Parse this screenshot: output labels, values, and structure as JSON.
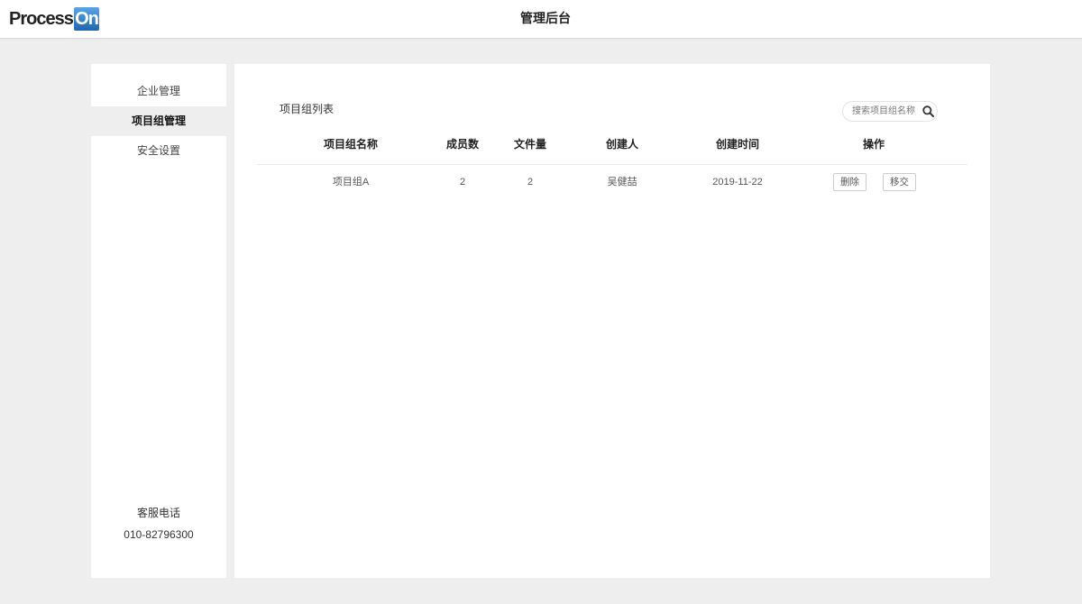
{
  "app": {
    "logo_text": "Process",
    "logo_badge": "On",
    "title": "管理后台"
  },
  "colors": {
    "background": "#eeeeee",
    "panel": "#ffffff",
    "logo_badge": "#2a75c2",
    "selected_menu": "#eeeeee"
  },
  "sidebar": {
    "items": [
      {
        "label": "企业管理",
        "selected": false
      },
      {
        "label": "项目组管理",
        "selected": true
      },
      {
        "label": "安全设置",
        "selected": false
      }
    ],
    "support": {
      "label": "客服电话",
      "phone": "010-82796300"
    }
  },
  "main": {
    "title": "项目组列表",
    "search": {
      "placeholder": "搜索项目组名称",
      "icon": "search-icon"
    },
    "table": {
      "columns": [
        "项目组名称",
        "成员数",
        "文件量",
        "创建人",
        "创建时间",
        "操作"
      ],
      "rows": [
        {
          "name": "项目组A",
          "members": "2",
          "files": "2",
          "creator": "吴健喆",
          "created": "2019-11-22",
          "actions": [
            "删除",
            "移交"
          ]
        }
      ]
    }
  }
}
